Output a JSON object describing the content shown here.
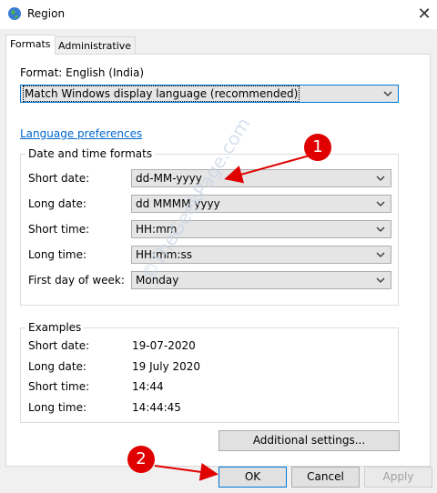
{
  "window": {
    "title": "Region",
    "close_glyph": "✕"
  },
  "tabs": [
    {
      "label": "Formats"
    },
    {
      "label": "Administrative"
    }
  ],
  "format": {
    "label": "Format: English (India)",
    "value": "Match Windows display language (recommended)"
  },
  "language_link": "Language preferences",
  "datetime_group": {
    "title": "Date and time formats",
    "rows": [
      {
        "label": "Short date:",
        "value": "dd-MM-yyyy"
      },
      {
        "label": "Long date:",
        "value": "dd MMMM yyyy"
      },
      {
        "label": "Short time:",
        "value": "HH:mm"
      },
      {
        "label": "Long time:",
        "value": "HH:mm:ss"
      },
      {
        "label": "First day of week:",
        "value": "Monday"
      }
    ]
  },
  "examples": {
    "title": "Examples",
    "rows": [
      {
        "label": "Short date:",
        "value": "19-07-2020"
      },
      {
        "label": "Long date:",
        "value": "19 July 2020"
      },
      {
        "label": "Short time:",
        "value": "14:44"
      },
      {
        "label": "Long time:",
        "value": "14:44:45"
      }
    ]
  },
  "additional_settings_label": "Additional settings...",
  "buttons": {
    "ok": "OK",
    "cancel": "Cancel",
    "apply": "Apply"
  },
  "annotations": {
    "badge1": "1",
    "badge2": "2",
    "color": "#e00000"
  },
  "watermark": "©TheGeekPage.com"
}
